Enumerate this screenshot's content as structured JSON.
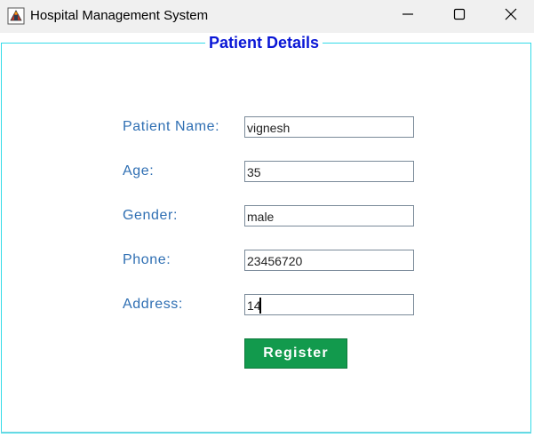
{
  "window": {
    "title": "Hospital Management System",
    "controls": [
      "minimize-icon",
      "maximize-icon",
      "close-icon"
    ]
  },
  "form": {
    "group_title": "Patient Details",
    "fields": [
      {
        "label": "Patient Name:",
        "value": "vignesh"
      },
      {
        "label": "Age:",
        "value": "35"
      },
      {
        "label": "Gender:",
        "value": "male"
      },
      {
        "label": "Phone:",
        "value": "23456720"
      },
      {
        "label": "Address:",
        "value": "14"
      }
    ],
    "register_label": "Register"
  },
  "colors": {
    "group_title": "#0a17d6",
    "label": "#2f6fb3",
    "border": "#33dbe8",
    "button": "#129a4d"
  }
}
